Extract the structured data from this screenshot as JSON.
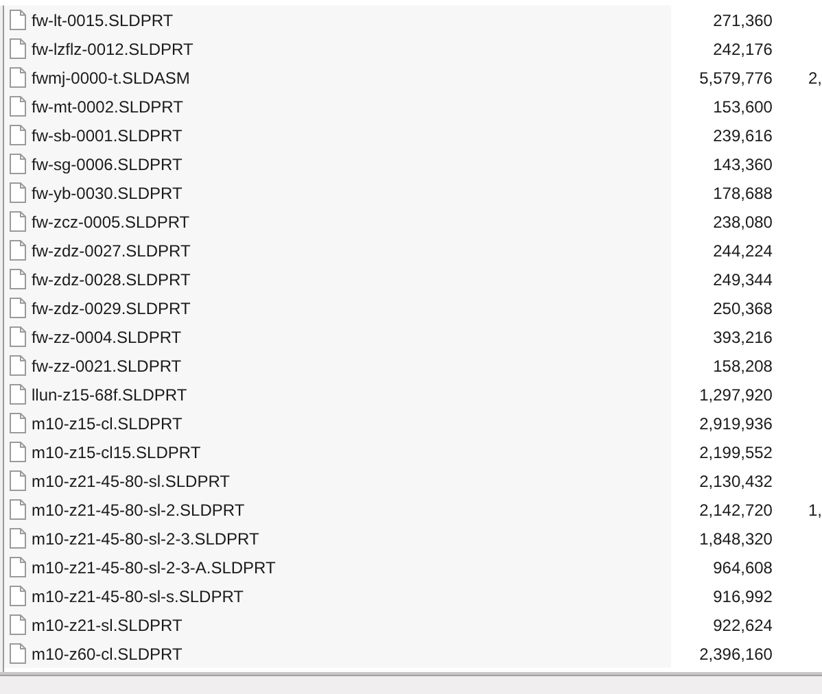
{
  "files": [
    {
      "name": "fw-lt-0015.SLDPRT",
      "size": "271,360"
    },
    {
      "name": "fw-lzflz-0012.SLDPRT",
      "size": "242,176"
    },
    {
      "name": "fwmj-0000-t.SLDASM",
      "size": "5,579,776",
      "column_3": "2,"
    },
    {
      "name": "fw-mt-0002.SLDPRT",
      "size": "153,600"
    },
    {
      "name": "fw-sb-0001.SLDPRT",
      "size": "239,616"
    },
    {
      "name": "fw-sg-0006.SLDPRT",
      "size": "143,360"
    },
    {
      "name": "fw-yb-0030.SLDPRT",
      "size": "178,688"
    },
    {
      "name": "fw-zcz-0005.SLDPRT",
      "size": "238,080"
    },
    {
      "name": "fw-zdz-0027.SLDPRT",
      "size": "244,224"
    },
    {
      "name": "fw-zdz-0028.SLDPRT",
      "size": "249,344"
    },
    {
      "name": "fw-zdz-0029.SLDPRT",
      "size": "250,368"
    },
    {
      "name": "fw-zz-0004.SLDPRT",
      "size": "393,216"
    },
    {
      "name": "fw-zz-0021.SLDPRT",
      "size": "158,208"
    },
    {
      "name": "llun-z15-68f.SLDPRT",
      "size": "1,297,920"
    },
    {
      "name": "m10-z15-cl.SLDPRT",
      "size": "2,919,936"
    },
    {
      "name": "m10-z15-cl15.SLDPRT",
      "size": "2,199,552"
    },
    {
      "name": "m10-z21-45-80-sl.SLDPRT",
      "size": "2,130,432"
    },
    {
      "name": "m10-z21-45-80-sl-2.SLDPRT",
      "size": "2,142,720",
      "column_3": "1,"
    },
    {
      "name": "m10-z21-45-80-sl-2-3.SLDPRT",
      "size": "1,848,320"
    },
    {
      "name": "m10-z21-45-80-sl-2-3-A.SLDPRT",
      "size": "964,608"
    },
    {
      "name": "m10-z21-45-80-sl-s.SLDPRT",
      "size": "916,992"
    },
    {
      "name": "m10-z21-sl.SLDPRT",
      "size": "922,624"
    },
    {
      "name": "m10-z60-cl.SLDPRT",
      "size": "2,396,160"
    }
  ]
}
